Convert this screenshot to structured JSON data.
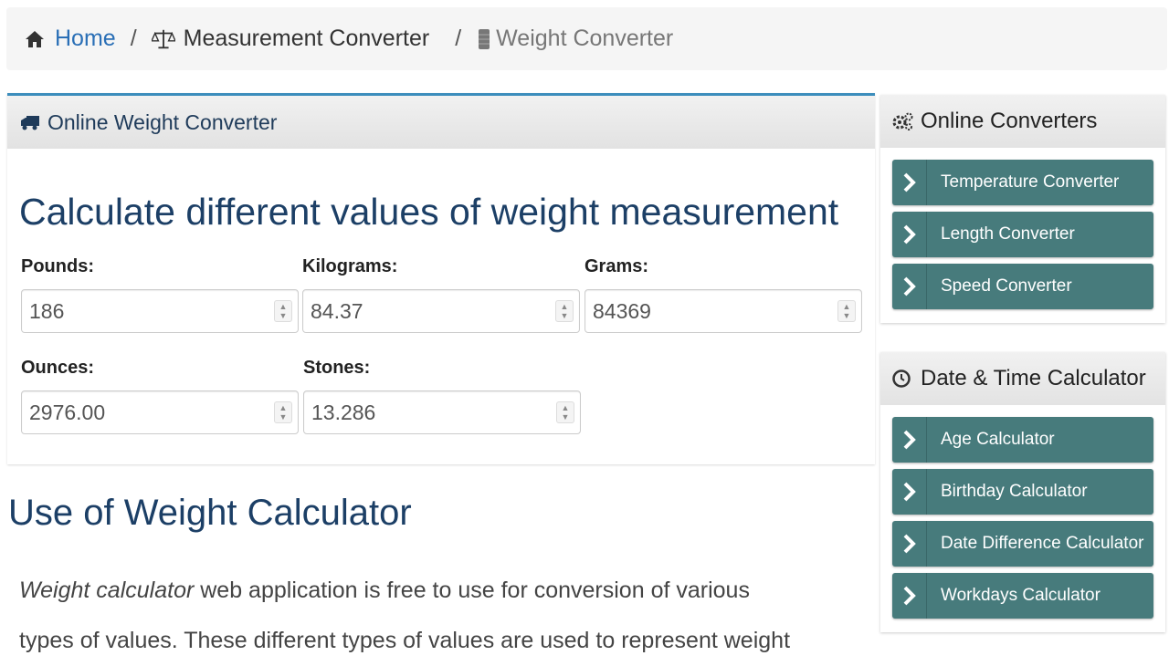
{
  "breadcrumb": {
    "home": "Home",
    "separator": "/",
    "parent": "Measurement Converter",
    "current": "Weight Converter"
  },
  "main_panel": {
    "header": "Online Weight Converter",
    "title": "Calculate different values of weight measurement",
    "fields": {
      "pounds": {
        "label": "Pounds:",
        "value": "186"
      },
      "kilograms": {
        "label": "Kilograms:",
        "value": "84.37"
      },
      "grams": {
        "label": "Grams:",
        "value": "84369"
      },
      "ounces": {
        "label": "Ounces:",
        "value": "2976.00"
      },
      "stones": {
        "label": "Stones:",
        "value": "13.286"
      }
    }
  },
  "use_section": {
    "title": "Use of Weight Calculator",
    "italic_lead": "Weight calculator",
    "text_line1": " web application is free to use for conversion of various",
    "text_line2": "types of values. These different types of values are used to represent weight"
  },
  "sidebar": {
    "converters": {
      "header": "Online Converters",
      "items": [
        "Temperature Converter",
        "Length Converter",
        "Speed Converter"
      ]
    },
    "datetime": {
      "header": "Date & Time Calculator",
      "items": [
        "Age Calculator",
        "Birthday Calculator",
        "Date Difference Calculator",
        "Workdays Calculator"
      ]
    }
  },
  "colors": {
    "accent": "#3c8dbc",
    "sidebar_button": "#477b7c",
    "heading": "#1c3f66",
    "link": "#2a6fb6"
  }
}
